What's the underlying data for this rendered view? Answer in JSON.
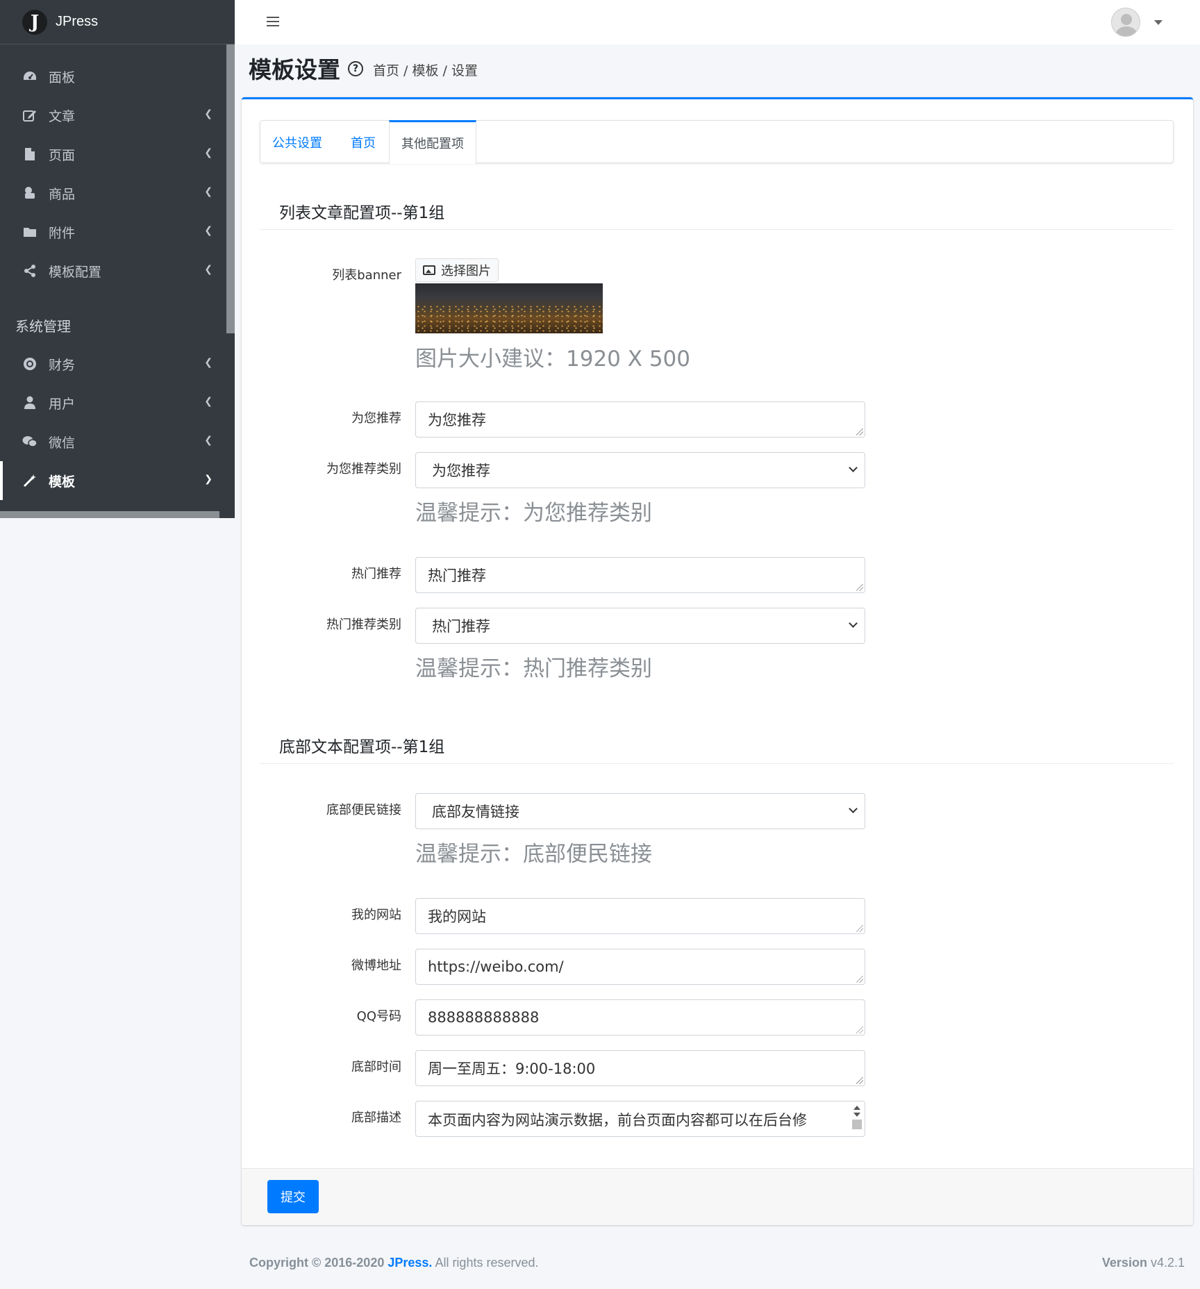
{
  "app": {
    "name": "JPress",
    "logo_letter": "J"
  },
  "sidebar": {
    "items": [
      {
        "label": "面板",
        "icon": "dashboard-icon",
        "has_children": false
      },
      {
        "label": "文章",
        "icon": "edit-icon",
        "has_children": true
      },
      {
        "label": "页面",
        "icon": "file-icon",
        "has_children": true
      },
      {
        "label": "商品",
        "icon": "product-icon",
        "has_children": true
      },
      {
        "label": "附件",
        "icon": "folder-icon",
        "has_children": true
      },
      {
        "label": "模板配置",
        "icon": "share-icon",
        "has_children": true
      }
    ],
    "section_header": "系统管理",
    "system_items": [
      {
        "label": "财务",
        "icon": "finance-icon",
        "has_children": true
      },
      {
        "label": "用户",
        "icon": "user-icon",
        "has_children": true
      },
      {
        "label": "微信",
        "icon": "wechat-icon",
        "has_children": true
      },
      {
        "label": "模板",
        "icon": "magic-icon",
        "has_children": true,
        "active": true
      }
    ]
  },
  "header": {
    "title": "模板设置",
    "breadcrumb": "首页 / 模板 / 设置"
  },
  "tabs": [
    {
      "label": "公共设置",
      "active": false
    },
    {
      "label": "首页",
      "active": false
    },
    {
      "label": "其他配置项",
      "active": true
    }
  ],
  "sections": {
    "list": {
      "title": "列表文章配置项--第1组",
      "banner_label": "列表banner",
      "banner_button": "选择图片",
      "banner_hint": "图片大小建议：1920 X 500",
      "recommend_label": "为您推荐",
      "recommend_value": "为您推荐",
      "recommend_cat_label": "为您推荐类别",
      "recommend_cat_value": "为您推荐",
      "recommend_cat_hint": "温馨提示：为您推荐类别",
      "hot_label": "热门推荐",
      "hot_value": "热门推荐",
      "hot_cat_label": "热门推荐类别",
      "hot_cat_value": "热门推荐",
      "hot_cat_hint": "温馨提示：热门推荐类别"
    },
    "footer": {
      "title": "底部文本配置项--第1组",
      "links_label": "底部便民链接",
      "links_value": "底部友情链接",
      "links_hint": "温馨提示：底部便民链接",
      "site_label": "我的网站",
      "site_value": "我的网站",
      "weibo_label": "微博地址",
      "weibo_value": "https://weibo.com/",
      "qq_label": "QQ号码",
      "qq_value": "888888888888",
      "time_label": "底部时间",
      "time_value": "周一至周五：9:00-18:00",
      "desc_label": "底部描述",
      "desc_value": "本页面内容为网站演示数据，前台页面内容都可以在后台修"
    }
  },
  "actions": {
    "submit": "提交"
  },
  "footer": {
    "copyright_prefix": "Copyright © 2016-2020",
    "brand": "JPress.",
    "rights": "All rights reserved.",
    "version_label": "Version",
    "version": "v4.2.1"
  },
  "colors": {
    "sidebar_bg": "#343a40",
    "accent": "#007bff",
    "page_bg": "#f4f6f9"
  }
}
